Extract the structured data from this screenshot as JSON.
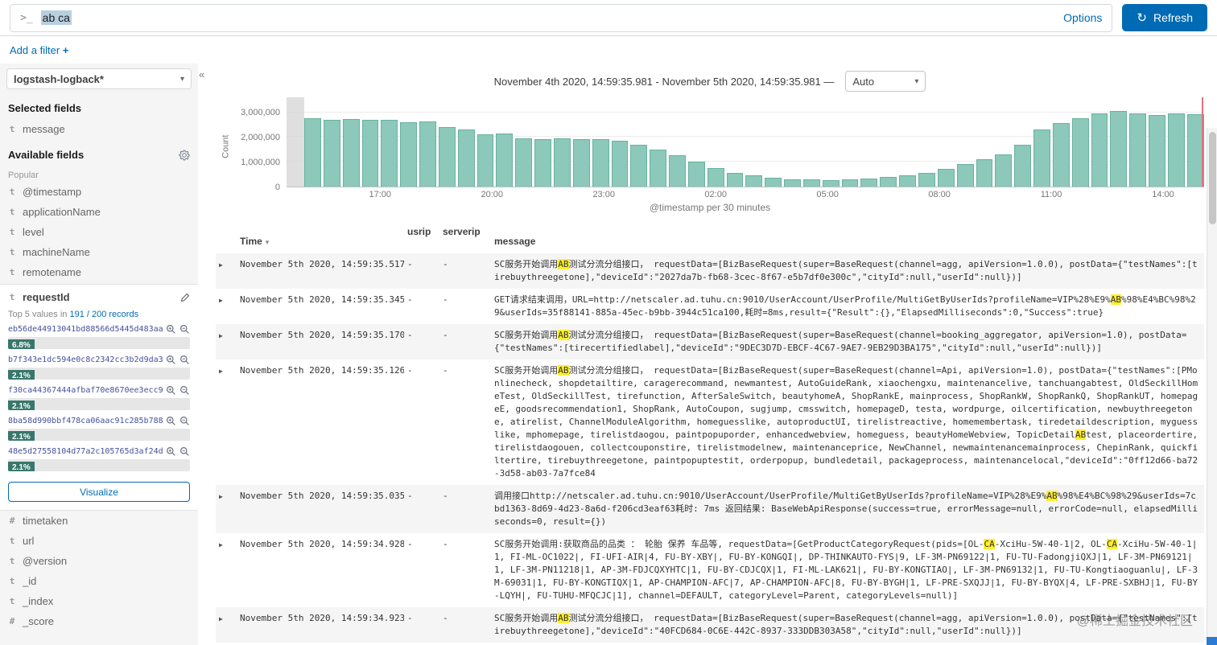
{
  "icons": {
    "refresh": "↻",
    "caret_down": "▾",
    "caret_right": "▶",
    "collapse": "«",
    "sort_desc": "▾"
  },
  "query_bar": {
    "prompt": ">_",
    "query": "ab ca",
    "options_label": "Options",
    "refresh_label": "Refresh"
  },
  "filter_bar": {
    "add_filter_label": "Add a filter ",
    "plus": "+"
  },
  "sidebar": {
    "index_pattern": "logstash-logback*",
    "selected_fields_label": "Selected fields",
    "selected_fields": [
      {
        "type": "t",
        "name": "message"
      }
    ],
    "available_fields_label": "Available fields",
    "popular_label": "Popular",
    "popular_fields": [
      {
        "type": "t",
        "name": "@timestamp"
      },
      {
        "type": "t",
        "name": "applicationName"
      },
      {
        "type": "t",
        "name": "level"
      },
      {
        "type": "t",
        "name": "machineName"
      },
      {
        "type": "t",
        "name": "remotename"
      }
    ],
    "request_id": {
      "type": "t",
      "name": "requestId",
      "summary_prefix": "Top 5 values in",
      "summary_link": "191 / 200 records",
      "top_values": [
        {
          "value": "eb56de44913041bd88566d5445d483aa",
          "percent": "6.8%"
        },
        {
          "value": "b7f343e1dc594e0c8c2342cc3b2d9da3",
          "percent": "2.1%"
        },
        {
          "value": "f30ca44367444afbaf70e8670ee3ecc9",
          "percent": "2.1%"
        },
        {
          "value": "8ba58d990bbf478ca06aac91c285b788",
          "percent": "2.1%"
        },
        {
          "value": "48e5d27558104d77a2c105765d3af24d",
          "percent": "2.1%"
        }
      ],
      "visualize_label": "Visualize"
    },
    "other_fields": [
      {
        "type": "#",
        "name": "timetaken"
      },
      {
        "type": "t",
        "name": "url"
      },
      {
        "type": "t",
        "name": "@version"
      },
      {
        "type": "t",
        "name": "_id"
      },
      {
        "type": "t",
        "name": "_index"
      },
      {
        "type": "#",
        "name": "_score"
      }
    ]
  },
  "timepicker": {
    "range": "November 4th 2020, 14:59:35.981 - November 5th 2020, 14:59:35.981 —",
    "interval": "Auto"
  },
  "chart_data": {
    "type": "bar",
    "title": "",
    "ylabel": "Count",
    "xlabel": "@timestamp per 30 minutes",
    "x_ticks": [
      "17:00",
      "20:00",
      "23:00",
      "02:00",
      "05:00",
      "08:00",
      "11:00",
      "14:00"
    ],
    "y_ticks": [
      "0",
      "1,000,000",
      "2,000,000",
      "3,000,000"
    ],
    "y_tick_values": [
      0,
      1000000,
      2000000,
      3000000
    ],
    "ylim": [
      0,
      3600000
    ],
    "bar_color": "#8CC9BA",
    "values": [
      2750000,
      2700000,
      2720000,
      2680000,
      2700000,
      2600000,
      2620000,
      2400000,
      2300000,
      2120000,
      2150000,
      1950000,
      1920000,
      1950000,
      1900000,
      1930000,
      1850000,
      1700000,
      1500000,
      1250000,
      1000000,
      750000,
      550000,
      450000,
      360000,
      300000,
      280000,
      270000,
      300000,
      330000,
      380000,
      450000,
      550000,
      700000,
      900000,
      1100000,
      1300000,
      1700000,
      2300000,
      2550000,
      2750000,
      2950000,
      3050000,
      2950000,
      2900000,
      2950000,
      2920000
    ]
  },
  "table": {
    "columns": [
      "Time",
      "usrip",
      "serverip",
      "message"
    ],
    "rows": [
      {
        "time": "November 5th 2020, 14:59:35.517",
        "usrip": "-",
        "serverip": "-",
        "message": "SC服务开始调用~~AB~~测试分流分组接口， requestData=[BizBaseRequest(super=BaseRequest(channel=agg, apiVersion=1.0.0), postData={\"testNames\":[tirebuythreegetone],\"deviceId\":\"2027da7b-fb68-3cec-8f67-e5b7df0e300c\",\"cityId\":null,\"userId\":null})]"
      },
      {
        "time": "November 5th 2020, 14:59:35.345",
        "usrip": "-",
        "serverip": "-",
        "message": "GET请求结束调用，URL=http://netscaler.ad.tuhu.cn:9010/UserAccount/UserProfile/MultiGetByUserIds?profileName=VIP%28%E9%~~AB~~%98%E4%BC%98%29&userIds=35f88141-885a-45ec-b9bb-3944c51ca100,耗时=8ms,result={\"Result\":{},\"ElapsedMilliseconds\":0,\"Success\":true}"
      },
      {
        "time": "November 5th 2020, 14:59:35.170",
        "usrip": "-",
        "serverip": "-",
        "message": "SC服务开始调用~~AB~~测试分流分组接口， requestData=[BizBaseRequest(super=BaseRequest(channel=booking_aggregator, apiVersion=1.0), postData={\"testNames\":[tirecertifiedlabel],\"deviceId\":\"9DEC3D7D-EBCF-4C67-9AE7-9EB29D3BA175\",\"cityId\":null,\"userId\":null})]"
      },
      {
        "time": "November 5th 2020, 14:59:35.126",
        "usrip": "-",
        "serverip": "-",
        "message": "SC服务开始调用~~AB~~测试分流分组接口， requestData=[BizBaseRequest(super=BaseRequest(channel=Api, apiVersion=1.0), postData={\"testNames\":[PMonlinecheck, shopdetailtire, caragerecommand, newmantest, AutoGuideRank, xiaochengxu, maintenancelive, tanchuangabtest, OldSeckillHomeTest, OldSeckillTest, tirefunction, AfterSaleSwitch, beautyhomeA, ShopRankE, mainprocess, ShopRankW, ShopRankQ, ShopRankUT, homepageE, goodsrecommendation1, ShopRank, AutoCoupon, sugjump, cmsswitch, homepageD, testa, wordpurge, oilcertification, newbuythreegetone, atirelist, ChannelModuleAlgorithm, homeguesslike, autoproductUI, tirelistreactive, homemembertask, tiredetaildescription, myguesslike, mphomepage, tirelistdaogou, paintpopuporder, enhancedwebview, homeguess, beautyHomeWebview, TopicDetail~~AB~~test, placeordertire, tirelistdaogouen, collectcouponstire, tirelistmodelnew, maintenanceprice, NewChannel, newmaintenancemainprocess, ChepinRank, quickfiltertire, tirebuythreegetone, paintpopuptestit, orderpopup, bundledetail, packageprocess, maintenancelocal,\"deviceId\":\"0ff12d66-ba72-3d58-ab03-7a7fce84"
      },
      {
        "time": "November 5th 2020, 14:59:35.035",
        "usrip": "-",
        "serverip": "-",
        "message": "调用接口http://netscaler.ad.tuhu.cn:9010/UserAccount/UserProfile/MultiGetByUserIds?profileName=VIP%28%E9%~~AB~~%98%E4%BC%98%29&userIds=7cbd1363-8d69-4d23-8a6d-f206cd3eaf63耗时: 7ms 返回结果: BaseWebApiResponse(success=true, errorMessage=null, errorCode=null, elapsedMilliseconds=0, result={})"
      },
      {
        "time": "November 5th 2020, 14:59:34.928",
        "usrip": "-",
        "serverip": "-",
        "message": "SC服务开始调用:获取商品的品类 ： 轮胎 保养 车品等, requestData=[GetProductCategoryRequest(pids=[OL-~~CA~~-XciHu-5W-40-1|2, OL-~~CA~~-XciHu-5W-40-1|1, FI-ML-OC1022|, FI-UFI-AIR|4, FU-BY-XBY|, FU-BY-KONGQI|, DP-THINKAUTO-FYS|9, LF-3M-PN69122|1, FU-TU-FadongjiQXJ|1, LF-3M-PN69121|1, LF-3M-PN11218|1, AP-3M-FDJCQXYHTC|1, FU-BY-CDJCQX|1, FI-ML-LAK621|, FU-BY-KONGTIAO|, LF-3M-PN69132|1, FU-TU-Kongtiaoguanlu|, LF-3M-69031|1, FU-BY-KONGTIQX|1, AP-CHAMPION-AFC|7, AP-CHAMPION-AFC|8, FU-BY-BYGH|1, LF-PRE-SXQJJ|1, FU-BY-BYQX|4, LF-PRE-SXBHJ|1, FU-BY-LQYH|, FU-TUHU-MFQCJC|1], channel=DEFAULT, categoryLevel=Parent, categoryLevels=null)]"
      },
      {
        "time": "November 5th 2020, 14:59:34.923",
        "usrip": "-",
        "serverip": "-",
        "message": "SC服务开始调用~~AB~~测试分流分组接口， requestData=[BizBaseRequest(super=BaseRequest(channel=agg, apiVersion=1.0.0), postData={\"testNames\":[tirebuythreegetone],\"deviceId\":\"40FCD684-0C6E-442C-8937-333DDB303A58\",\"cityId\":null,\"userId\":null})]"
      }
    ]
  },
  "watermark": "@稀土掘金技术社区"
}
